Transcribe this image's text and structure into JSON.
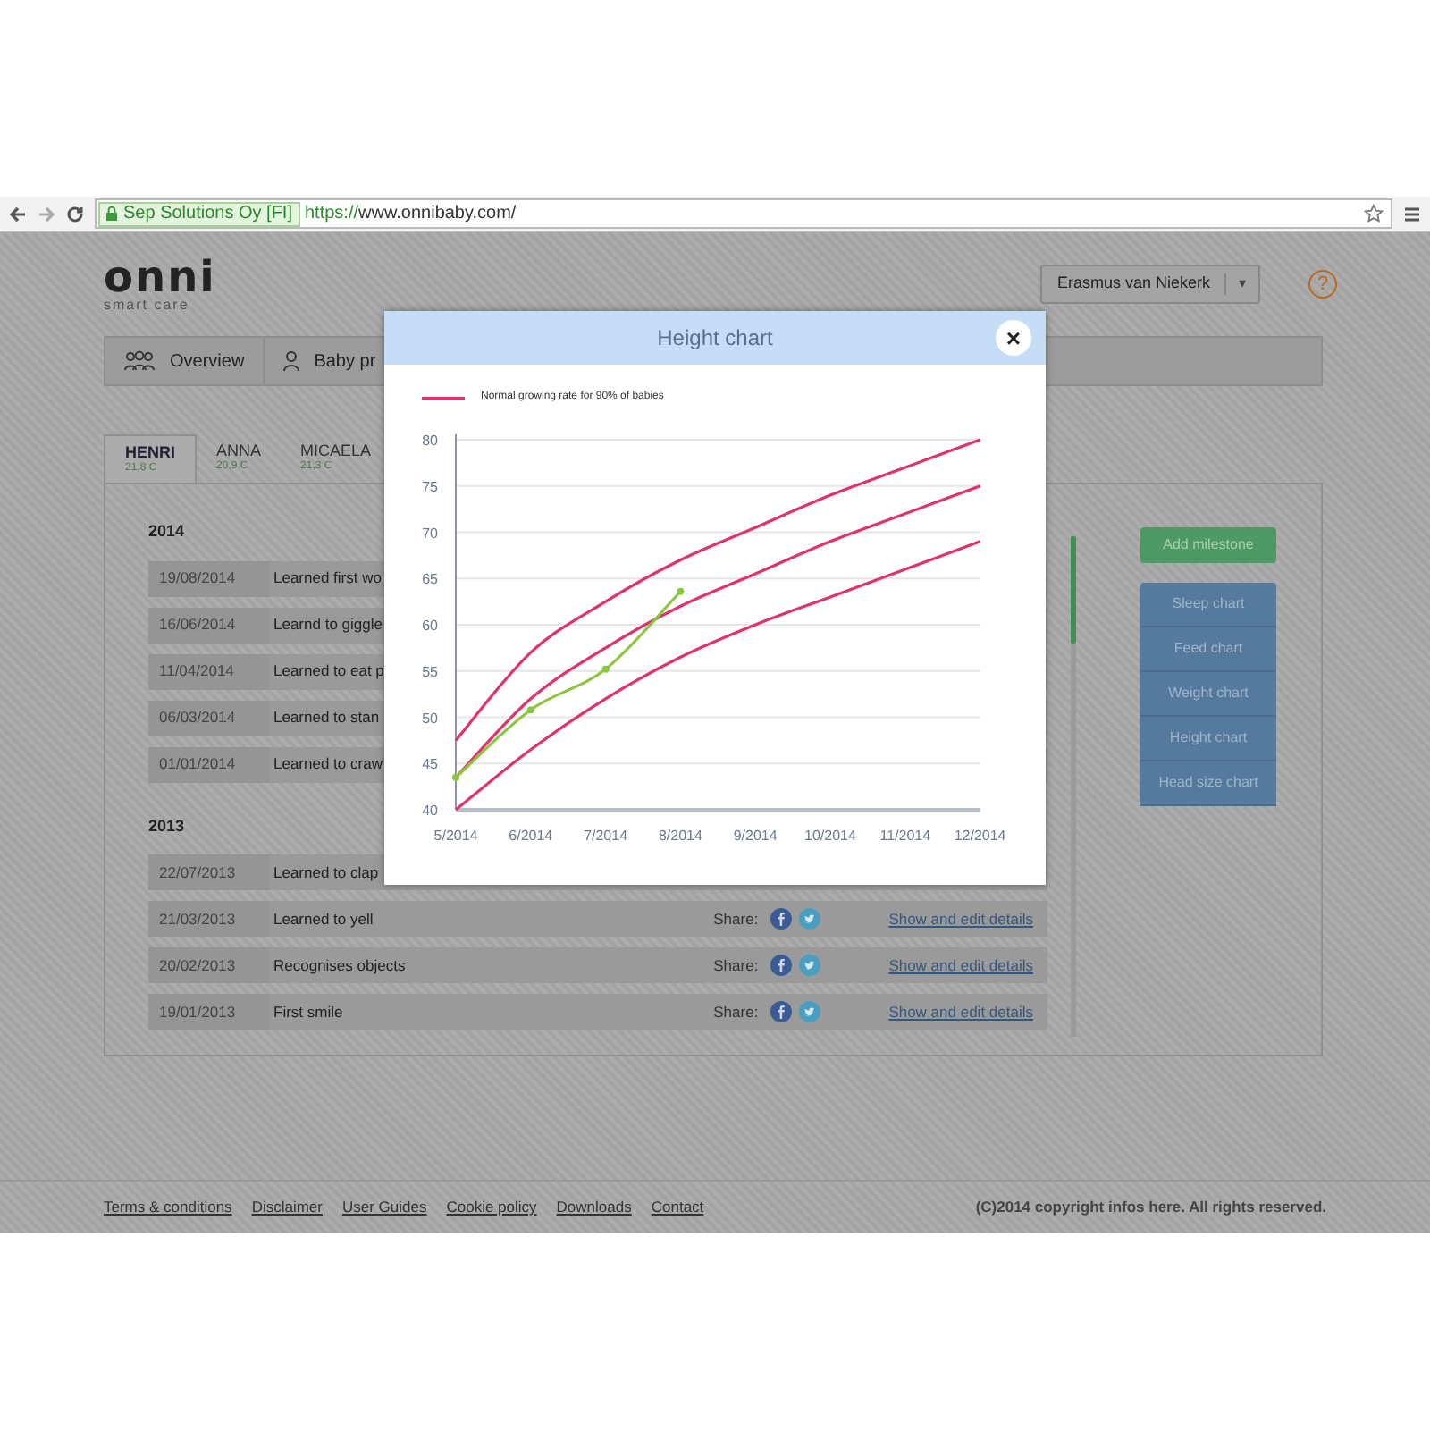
{
  "browser": {
    "identity": "Sep Solutions Oy [FI]",
    "url_scheme": "https://",
    "url_rest": "www.onnibaby.com/"
  },
  "header": {
    "logo": "onni",
    "tagline": "smart care",
    "user": "Erasmus van Niekerk",
    "user_caret": "▾",
    "help": "?"
  },
  "nav": [
    {
      "kind": "group",
      "label": "Overview"
    },
    {
      "kind": "person",
      "label": "Baby pr"
    }
  ],
  "tabs": [
    {
      "name": "HENRI",
      "temp": "21,8 C",
      "selected": true
    },
    {
      "name": "ANNA",
      "temp": "20,9 C",
      "selected": false
    },
    {
      "name": "MICAELA",
      "temp": "21,3 C",
      "selected": false
    }
  ],
  "years": [
    {
      "year": "2014",
      "rows": [
        {
          "date": "19/08/2014",
          "title": "Learned first wo"
        },
        {
          "date": "16/06/2014",
          "title": "Learnd to giggle"
        },
        {
          "date": "11/04/2014",
          "title": "Learned to eat p"
        },
        {
          "date": "06/03/2014",
          "title": "Learned to stan"
        },
        {
          "date": "01/01/2014",
          "title": "Learned to craw"
        }
      ]
    },
    {
      "year": "2013",
      "rows": [
        {
          "date": "22/07/2013",
          "title": "Learned to clap"
        },
        {
          "date": "21/03/2013",
          "title": "Learned to yell",
          "share_label": "Share:",
          "link": "Show and edit details"
        },
        {
          "date": "20/02/2013",
          "title": "Recognises objects",
          "share_label": "Share:",
          "link": "Show and edit details"
        },
        {
          "date": "19/01/2013",
          "title": "First smile",
          "share_label": "Share:",
          "link": "Show and edit details"
        }
      ]
    }
  ],
  "side": {
    "add": "Add milestone",
    "charts": [
      "Sleep chart",
      "Feed chart",
      "Weight chart",
      "Height chart",
      "Head size chart"
    ]
  },
  "footer": {
    "links": [
      "Terms & conditions",
      "Disclaimer",
      "User Guides",
      "Cookie policy",
      "Downloads",
      "Contact"
    ],
    "copyright": "(C)2014 copyright infos here. All rights reserved."
  },
  "modal": {
    "title": "Height chart",
    "close": "×",
    "legend": {
      "label": "Normal growing rate for 90% of babies",
      "color": "#e0336e"
    },
    "chart_data": {
      "type": "line",
      "grid": true,
      "categories": [
        "5/2014",
        "6/2014",
        "7/2014",
        "8/2014",
        "9/2014",
        "10/2014",
        "11/2014",
        "12/2014"
      ],
      "ylim": [
        40,
        80
      ],
      "yticks": [
        40,
        45,
        50,
        55,
        60,
        65,
        70,
        75,
        80
      ],
      "series": [
        {
          "color": "#e0336e",
          "values": [
            47.5,
            57,
            62.5,
            67,
            70.5,
            74,
            77,
            80
          ]
        },
        {
          "color": "#e0336e",
          "values": [
            43.5,
            52,
            57.5,
            62,
            65.5,
            69,
            72,
            75
          ]
        },
        {
          "color": "#e0336e",
          "values": [
            40,
            46.5,
            52,
            56.5,
            60,
            63,
            66,
            69
          ]
        },
        {
          "color": "#8cc63f",
          "marker": true,
          "values": [
            43.5,
            50.8,
            55.2,
            63.6,
            null,
            null,
            null,
            null
          ]
        }
      ]
    }
  }
}
